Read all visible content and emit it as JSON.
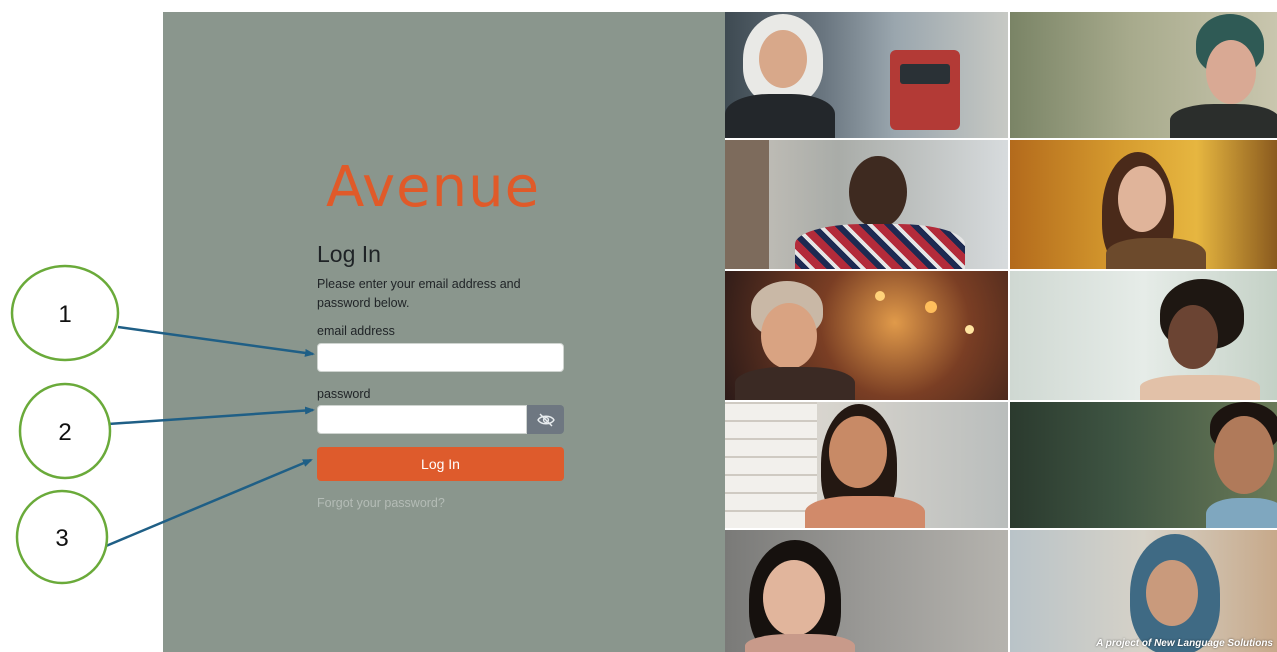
{
  "brand": {
    "logo_text": "Avenue",
    "logo_color": "#e05a29"
  },
  "login": {
    "title": "Log In",
    "instructions": "Please enter your email address and password below.",
    "email_label": "email address",
    "email_value": "",
    "password_label": "password",
    "password_value": "",
    "submit_label": "Log In",
    "forgot_label": "Forgot your password?",
    "toggle_icon": "eye-slash-icon",
    "panel_color": "#8a968d",
    "button_color": "#de5b2c"
  },
  "photos": {
    "credit": "A project of New Language Solutions"
  },
  "annotations": {
    "callouts": [
      {
        "number": "1",
        "target": "email-input"
      },
      {
        "number": "2",
        "target": "password-input"
      },
      {
        "number": "3",
        "target": "login-button"
      }
    ],
    "circle_color": "#6aaa3a",
    "arrow_color": "#1f5f86"
  }
}
